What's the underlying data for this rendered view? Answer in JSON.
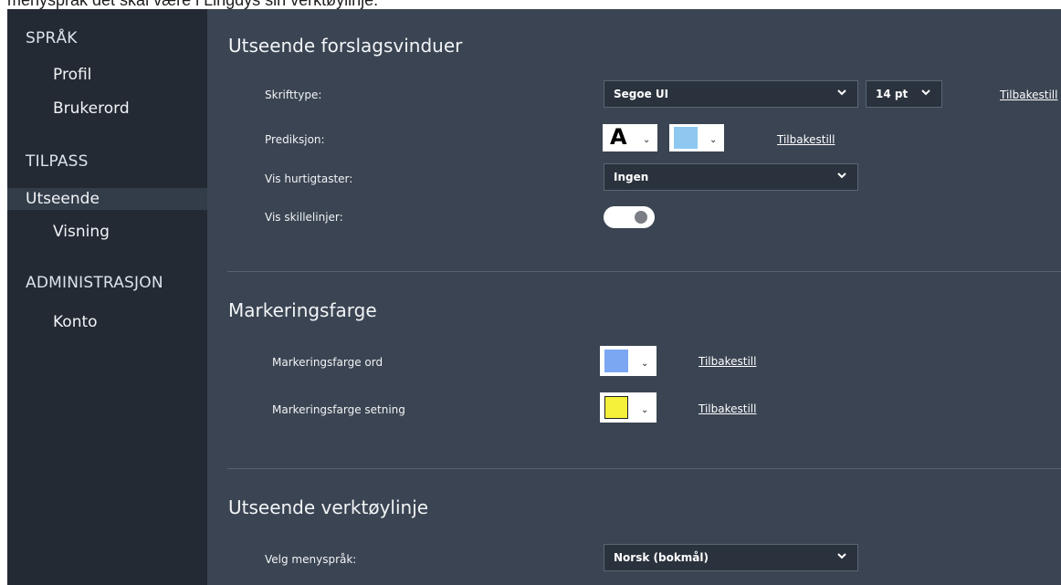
{
  "top_text": "menyspråk det skal være i Lingdys sin verktøylinje.",
  "sidebar": {
    "categories": [
      "SPRÅK",
      "TILPASS",
      "ADMINISTRASJON"
    ],
    "items": [
      {
        "label": "Profil"
      },
      {
        "label": "Brukerord"
      },
      {
        "label": "Utseende",
        "selected": true
      },
      {
        "label": "Visning"
      },
      {
        "label": "Konto"
      }
    ]
  },
  "sections": {
    "suggestions": {
      "title": "Utseende forslagsvinduer",
      "font_label": "Skrifttype:",
      "font_value": "Segoe UI",
      "size_value": "14 pt",
      "font_reset": "Tilbakestill",
      "prediction_label": "Prediksjon:",
      "prediction_letter": "A",
      "prediction_reset": "Tilbakestill",
      "shortcuts_label": "Vis hurtigtaster:",
      "shortcuts_value": "Ingen",
      "dividers_label": "Vis skillelinjer:"
    },
    "highlight": {
      "title": "Markeringsfarge",
      "word_label": "Markeringsfarge ord",
      "word_reset": "Tilbakestill",
      "sentence_label": "Markeringsfarge setning",
      "sentence_reset": "Tilbakestill"
    },
    "toolbar": {
      "title": "Utseende verktøylinje",
      "language_label": "Velg menyspråk:",
      "language_value": "Norsk (bokmål)"
    }
  },
  "colors": {
    "prediction_bg": "#8ec8f0",
    "word_highlight": "#7ba7f2",
    "sentence_highlight": "#f5f03a",
    "toggle_on": "#ffffff"
  }
}
